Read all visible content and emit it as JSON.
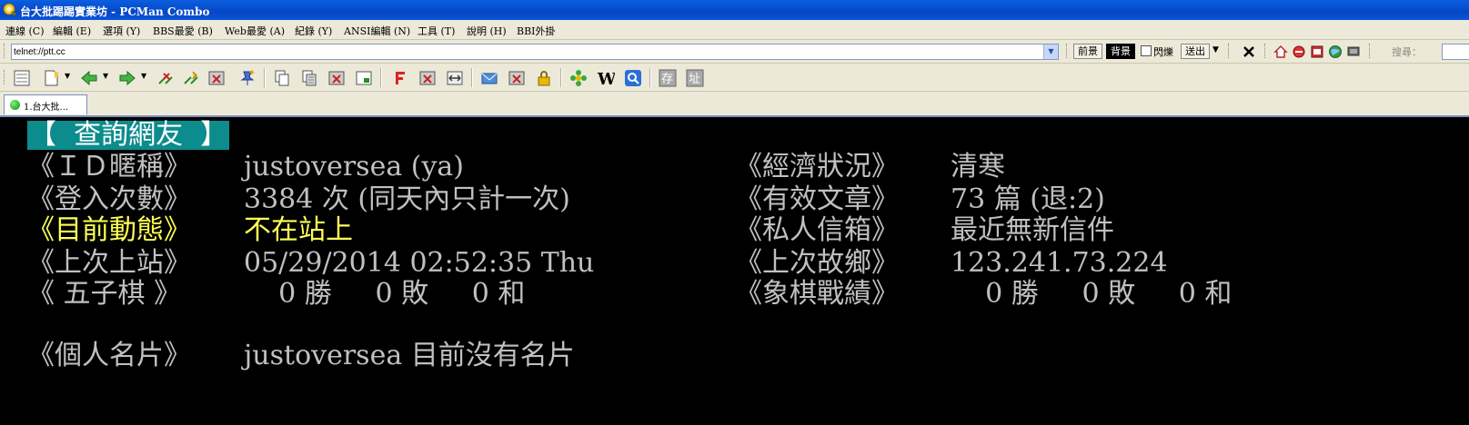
{
  "window": {
    "title": "台大批踢踢實業坊 - PCMan Combo"
  },
  "menu": [
    "連線 (C)",
    "編輯 (E)",
    "選項 (Y)",
    "BBS最愛 (B)",
    "Web最愛 (A)",
    "紀錄 (Y)",
    "ANSI編輯 (N)",
    "工具 (T)",
    "說明 (H)",
    "BBI外掛"
  ],
  "address": {
    "value": "telnet://ptt.cc"
  },
  "address_tools": {
    "fg_label": "前景",
    "bg_label": "背景",
    "blink_label": "閃爍",
    "send_label": "送出",
    "search_label": "搜尋："
  },
  "tabs": [
    {
      "label": "1.台大批..."
    }
  ],
  "terminal": {
    "header": "【  查詢網友  】",
    "rows": [
      {
        "left_label": "《ＩＤ暱稱》",
        "left_value": "justoversea (ya)",
        "right_label": "《經濟狀況》",
        "right_value": "清寒"
      },
      {
        "left_label": "《登入次數》",
        "left_value": "3384 次 (同天內只計一次)",
        "right_label": "《有效文章》",
        "right_value": "73 篇 (退:2)"
      },
      {
        "left_label": "《目前動態》",
        "left_value": "不在站上",
        "right_label": "《私人信箱》",
        "right_value": "最近無新信件"
      },
      {
        "left_label": "《上次上站》",
        "left_value": "05/29/2014 02:52:35 Thu",
        "right_label": "《上次故鄉》",
        "right_value": "123.241.73.224"
      },
      {
        "left_label": "《 五子棋 》",
        "left_value": "    0 勝     0 敗     0 和",
        "right_label": "《象棋戰績》",
        "right_value": "    0 勝     0 敗     0 和"
      }
    ],
    "card": {
      "label": "《個人名片》",
      "value": "justoversea 目前沒有名片"
    }
  },
  "colors": {
    "title_blue": "#0646c6",
    "terminal_bg": "#000000",
    "terminal_text": "#c0c0c0",
    "highlight_yellow": "#ffff55",
    "header_bg": "#0c8c8c"
  }
}
